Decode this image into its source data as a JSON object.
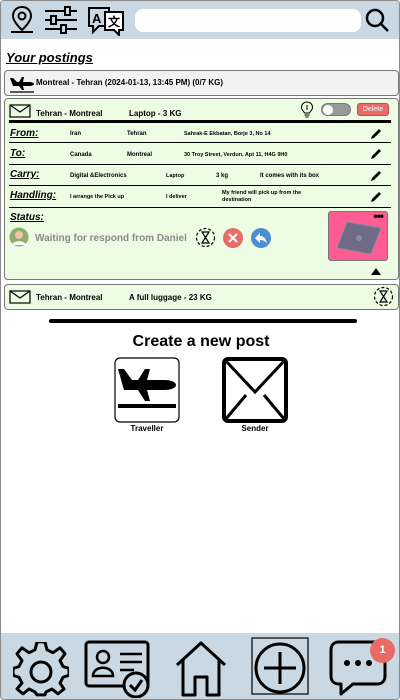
{
  "search": {
    "placeholder": ""
  },
  "postings": {
    "title": "Your postings",
    "items": [
      {
        "route": "Montreal - Tehran (2024-01-13, 13:45 PM) (0/7 KG)"
      }
    ],
    "expanded": {
      "route": "Tehran - Montreal",
      "summary": "Laptop - 3 KG",
      "delete_label": "Delete",
      "rows": {
        "from": {
          "label": "From:",
          "country": "Iran",
          "city": "Tehran",
          "address": "Sahrak-E Ekbatan, Borje 3, No 14"
        },
        "to": {
          "label": "To:",
          "country": "Canada",
          "city": "Montreal",
          "address": "30 Troy Street, Verdun, Apt 11, H4G 9H0"
        },
        "carry": {
          "label": "Carry:",
          "category": "Digital &Electronics",
          "item": "Laptop",
          "weight": "3 kg",
          "note": "It comes with its box"
        },
        "handling": {
          "label": "Handling:",
          "pickup": "I arrange the Pick up",
          "delivery": "I deliver",
          "note": "My friend will pick up from the destination"
        },
        "status": {
          "label": "Status:",
          "text": "Waiting for respond from Daniel"
        }
      }
    },
    "second": {
      "route": "Tehran - Montreal",
      "summary": "A full luggage - 23 KG"
    }
  },
  "create": {
    "title": "Create a new post",
    "traveller_label": "Traveller",
    "sender_label": "Sender"
  },
  "nav": {
    "badge_count": "1"
  },
  "colors": {
    "bar_bg": "#c9d8e2",
    "expanded_bg": "#edfde4",
    "delete_red": "#ea6b66",
    "reply_blue": "#4a8fd6",
    "photo_pink": "#ff5c92"
  }
}
